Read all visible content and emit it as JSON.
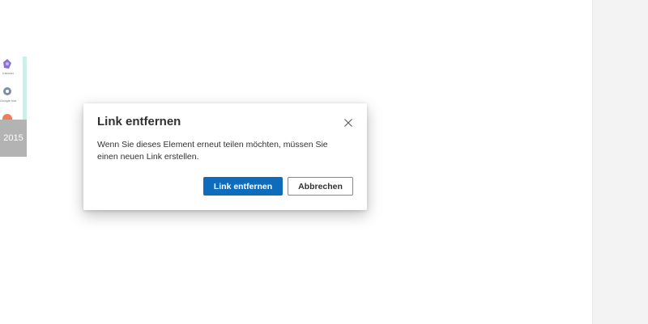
{
  "background": {
    "left_strip": {
      "year": "2015",
      "icon_captions": [
        "Internet",
        "Google Installati..."
      ]
    }
  },
  "dialog": {
    "title": "Link entfernen",
    "body": "Wenn Sie dieses Element erneut teilen möchten, müssen Sie einen neuen Link erstellen.",
    "primary_button_label": "Link entfernen",
    "secondary_button_label": "Abbrechen",
    "close_icon": "close-icon"
  },
  "colors": {
    "primary_button": "#0f6cbd",
    "title_text": "#323130",
    "year_badge": "#b3b3b3"
  }
}
